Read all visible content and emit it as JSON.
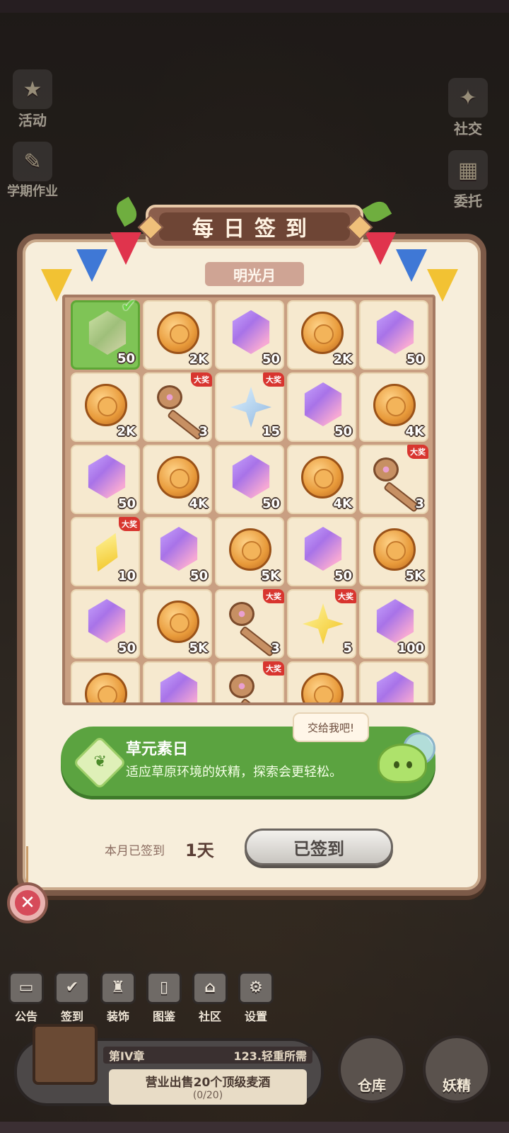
{
  "side_left": [
    {
      "label": "活动",
      "icon": "event-icon"
    },
    {
      "label": "学期作业",
      "icon": "homework-icon"
    }
  ],
  "side_right": [
    {
      "label": "社交",
      "icon": "social-icon"
    },
    {
      "label": "委托",
      "icon": "commission-icon"
    }
  ],
  "panel": {
    "title": "每日签到",
    "month": "明光月"
  },
  "rewards": [
    {
      "type": "gem-green",
      "qty": "50",
      "claimed": true,
      "grand": false
    },
    {
      "type": "coin",
      "qty": "2K",
      "claimed": false,
      "grand": false
    },
    {
      "type": "gem",
      "qty": "50",
      "claimed": false,
      "grand": false
    },
    {
      "type": "coin",
      "qty": "2K",
      "claimed": false,
      "grand": false
    },
    {
      "type": "gem",
      "qty": "50",
      "claimed": false,
      "grand": false
    },
    {
      "type": "coin",
      "qty": "2K",
      "claimed": false,
      "grand": false
    },
    {
      "type": "key",
      "qty": "3",
      "claimed": false,
      "grand": true
    },
    {
      "type": "star-blue",
      "qty": "15",
      "claimed": false,
      "grand": true
    },
    {
      "type": "gem",
      "qty": "50",
      "claimed": false,
      "grand": false
    },
    {
      "type": "coin",
      "qty": "4K",
      "claimed": false,
      "grand": false
    },
    {
      "type": "gem",
      "qty": "50",
      "claimed": false,
      "grand": false
    },
    {
      "type": "coin",
      "qty": "4K",
      "claimed": false,
      "grand": false
    },
    {
      "type": "gem",
      "qty": "50",
      "claimed": false,
      "grand": false
    },
    {
      "type": "coin",
      "qty": "4K",
      "claimed": false,
      "grand": false
    },
    {
      "type": "key",
      "qty": "3",
      "claimed": false,
      "grand": true
    },
    {
      "type": "shard",
      "qty": "10",
      "claimed": false,
      "grand": true
    },
    {
      "type": "gem",
      "qty": "50",
      "claimed": false,
      "grand": false
    },
    {
      "type": "coin",
      "qty": "5K",
      "claimed": false,
      "grand": false
    },
    {
      "type": "gem",
      "qty": "50",
      "claimed": false,
      "grand": false
    },
    {
      "type": "coin",
      "qty": "5K",
      "claimed": false,
      "grand": false
    },
    {
      "type": "gem",
      "qty": "50",
      "claimed": false,
      "grand": false
    },
    {
      "type": "coin",
      "qty": "5K",
      "claimed": false,
      "grand": false
    },
    {
      "type": "key",
      "qty": "3",
      "claimed": false,
      "grand": true
    },
    {
      "type": "star-yellow",
      "qty": "5",
      "claimed": false,
      "grand": true
    },
    {
      "type": "gem",
      "qty": "100",
      "claimed": false,
      "grand": false
    },
    {
      "type": "coin",
      "qty": "",
      "claimed": false,
      "grand": false
    },
    {
      "type": "gem",
      "qty": "",
      "claimed": false,
      "grand": false
    },
    {
      "type": "key",
      "qty": "",
      "claimed": false,
      "grand": true
    },
    {
      "type": "coin",
      "qty": "",
      "claimed": false,
      "grand": false
    },
    {
      "type": "gem",
      "qty": "",
      "claimed": false,
      "grand": false
    }
  ],
  "grand_label": "大奖",
  "element_day": {
    "title": "草元素日",
    "desc": "适应草原环境的妖精，探索会更轻松。",
    "bubble": "交给我吧!"
  },
  "signin": {
    "label": "本月已签到",
    "count": "1天",
    "button": "已签到"
  },
  "nav": [
    {
      "label": "公告",
      "icon": "announcement-icon",
      "glyph": "▭"
    },
    {
      "label": "签到",
      "icon": "checkin-icon",
      "glyph": "✔"
    },
    {
      "label": "装饰",
      "icon": "decor-icon",
      "glyph": "♜"
    },
    {
      "label": "图鉴",
      "icon": "codex-icon",
      "glyph": "▯"
    },
    {
      "label": "社区",
      "icon": "community-icon",
      "glyph": "⌂"
    },
    {
      "label": "设置",
      "icon": "settings-icon",
      "glyph": "⚙"
    }
  ],
  "quest": {
    "chapter": "第IV章",
    "subtitle": "123.轻重所需",
    "task": "营业出售20个顶级麦酒",
    "progress": "(0/20)"
  },
  "buttons": {
    "warehouse": "仓库",
    "fairy": "妖精"
  }
}
